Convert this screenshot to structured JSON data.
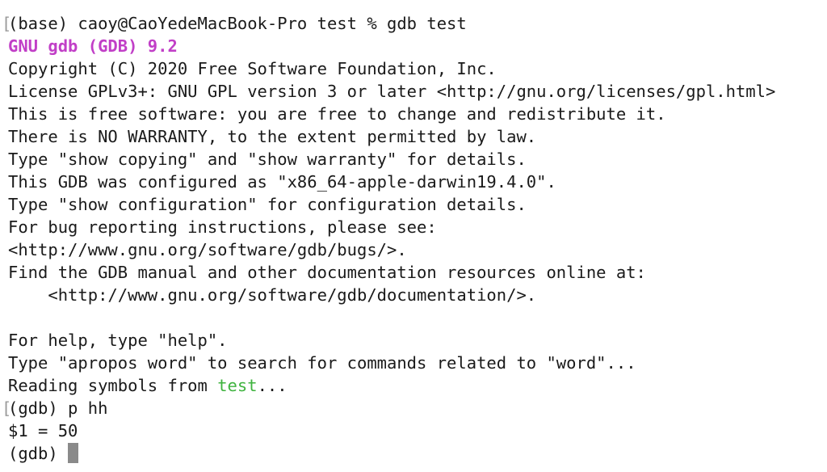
{
  "colors": {
    "background": "#ffffff",
    "text": "#1a1a1a",
    "gdb_version": "#c13fc7",
    "filename_highlight": "#3fb33f",
    "cursor": "#8a8a8a",
    "prompt_marker": "#9a9a9a"
  },
  "marker_glyph": "[",
  "terminal": {
    "shell_prompt": "(base) caoy@CaoYedeMacBook-Pro test % gdb test",
    "version_banner": "GNU gdb (GDB) 9.2",
    "copyright": "Copyright (C) 2020 Free Software Foundation, Inc.",
    "license": "License GPLv3+: GNU GPL version 3 or later <http://gnu.org/licenses/gpl.html>",
    "free_software": "This is free software: you are free to change and redistribute it.",
    "no_warranty": "There is NO WARRANTY, to the extent permitted by law.",
    "show_copying": "Type \"show copying\" and \"show warranty\" for details.",
    "configured_as": "This GDB was configured as \"x86_64-apple-darwin19.4.0\".",
    "show_configuration": "Type \"show configuration\" for configuration details.",
    "bug_reporting": "For bug reporting instructions, please see:",
    "bugs_url": "<http://www.gnu.org/software/gdb/bugs/>.",
    "find_manual": "Find the GDB manual and other documentation resources online at:",
    "docs_url": "    <http://www.gnu.org/software/gdb/documentation/>.",
    "blank": "",
    "help_hint": "For help, type \"help\".",
    "apropos_hint": "Type \"apropos word\" to search for commands related to \"word\"...",
    "reading_prefix": "Reading symbols from ",
    "reading_file": "test",
    "reading_suffix": "...",
    "gdb_command": "(gdb) p hh",
    "result": "$1 = 50",
    "current_prompt": "(gdb) "
  }
}
